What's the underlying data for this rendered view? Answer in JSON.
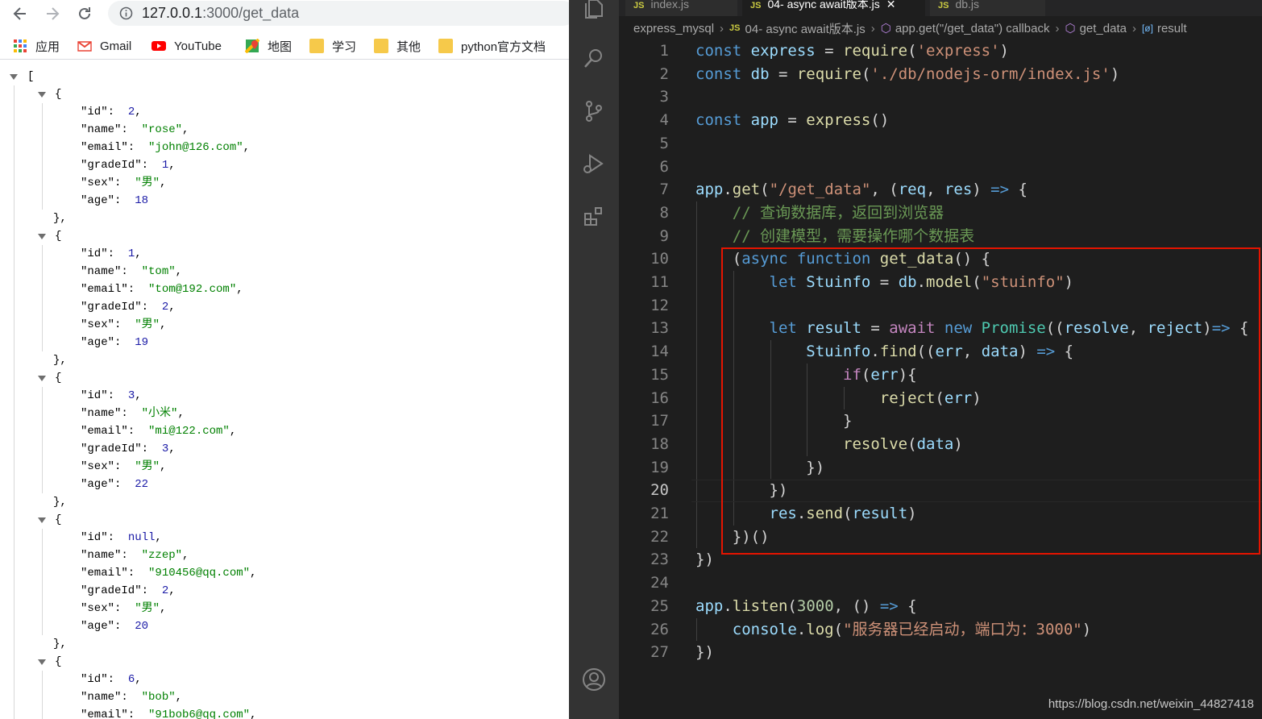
{
  "browser": {
    "url_host": "127.0.0.1",
    "url_path": ":3000/get_data",
    "bookmarks": [
      "应用",
      "Gmail",
      "YouTube",
      "地图",
      "学习",
      "其他",
      "python官方文档"
    ]
  },
  "json_records": [
    {
      "id": "2",
      "name": "\"rose\"",
      "email": "\"john@126.com\"",
      "gradeId": "1",
      "sex": "\"男\"",
      "age": "18"
    },
    {
      "id": "1",
      "name": "\"tom\"",
      "email": "\"tom@192.com\"",
      "gradeId": "2",
      "sex": "\"男\"",
      "age": "19"
    },
    {
      "id": "3",
      "name": "\"小米\"",
      "email": "\"mi@122.com\"",
      "gradeId": "3",
      "sex": "\"男\"",
      "age": "22"
    },
    {
      "id": "null",
      "name": "\"zzep\"",
      "email": "\"910456@qq.com\"",
      "gradeId": "2",
      "sex": "\"男\"",
      "age": "20"
    },
    {
      "id": "6",
      "name": "\"bob\"",
      "email": "\"91bob6@qq.com\""
    }
  ],
  "editor": {
    "tabs": [
      "index.js",
      "04- async await版本.js",
      "db.js"
    ],
    "breadcrumbs": [
      "express_mysql",
      "04- async await版本.js",
      "app.get(\"/get_data\") callback",
      "get_data",
      "result"
    ],
    "current_line": 20,
    "lines": [
      [
        [
          "kw",
          "const "
        ],
        [
          "var2",
          "express"
        ],
        [
          "pn",
          " = "
        ],
        [
          "fn",
          "require"
        ],
        [
          "pn",
          "("
        ],
        [
          "str",
          "'express'"
        ],
        [
          "pn",
          ")"
        ]
      ],
      [
        [
          "kw",
          "const "
        ],
        [
          "var2",
          "db"
        ],
        [
          "pn",
          " = "
        ],
        [
          "fn",
          "require"
        ],
        [
          "pn",
          "("
        ],
        [
          "str",
          "'./db/nodejs-orm/index.js'"
        ],
        [
          "pn",
          ")"
        ]
      ],
      [],
      [
        [
          "kw",
          "const "
        ],
        [
          "var2",
          "app"
        ],
        [
          "pn",
          " = "
        ],
        [
          "fn",
          "express"
        ],
        [
          "pn",
          "()"
        ]
      ],
      [],
      [],
      [
        [
          "var2",
          "app"
        ],
        [
          "pn",
          "."
        ],
        [
          "fn",
          "get"
        ],
        [
          "pn",
          "("
        ],
        [
          "str",
          "\"/get_data\""
        ],
        [
          "pn",
          ", ("
        ],
        [
          "var2",
          "req"
        ],
        [
          "pn",
          ", "
        ],
        [
          "var2",
          "res"
        ],
        [
          "pn",
          ") "
        ],
        [
          "kw",
          "=>"
        ],
        [
          "pn",
          " {"
        ]
      ],
      [
        [
          "pn",
          "    "
        ],
        [
          "cmt",
          "// 查询数据库，返回到浏览器"
        ]
      ],
      [
        [
          "pn",
          "    "
        ],
        [
          "cmt",
          "// 创建模型，需要操作哪个数据表"
        ]
      ],
      [
        [
          "pn",
          "    ("
        ],
        [
          "kw",
          "async function "
        ],
        [
          "fn",
          "get_data"
        ],
        [
          "pn",
          "() {"
        ]
      ],
      [
        [
          "pn",
          "        "
        ],
        [
          "kw",
          "let "
        ],
        [
          "var2",
          "Stuinfo"
        ],
        [
          "pn",
          " = "
        ],
        [
          "var2",
          "db"
        ],
        [
          "pn",
          "."
        ],
        [
          "fn",
          "model"
        ],
        [
          "pn",
          "("
        ],
        [
          "str",
          "\"stuinfo\""
        ],
        [
          "pn",
          ")"
        ]
      ],
      [],
      [
        [
          "pn",
          "        "
        ],
        [
          "kw",
          "let "
        ],
        [
          "var2",
          "result"
        ],
        [
          "pn",
          " = "
        ],
        [
          "ctl",
          "await "
        ],
        [
          "kw",
          "new "
        ],
        [
          "cls",
          "Promise"
        ],
        [
          "pn",
          "(("
        ],
        [
          "var2",
          "resolve"
        ],
        [
          "pn",
          ", "
        ],
        [
          "var2",
          "reject"
        ],
        [
          "pn",
          ")"
        ],
        [
          "kw",
          "=>"
        ],
        [
          "pn",
          " {"
        ]
      ],
      [
        [
          "pn",
          "            "
        ],
        [
          "var2",
          "Stuinfo"
        ],
        [
          "pn",
          "."
        ],
        [
          "fn",
          "find"
        ],
        [
          "pn",
          "(("
        ],
        [
          "var2",
          "err"
        ],
        [
          "pn",
          ", "
        ],
        [
          "var2",
          "data"
        ],
        [
          "pn",
          ") "
        ],
        [
          "kw",
          "=>"
        ],
        [
          "pn",
          " {"
        ]
      ],
      [
        [
          "pn",
          "                "
        ],
        [
          "ctl",
          "if"
        ],
        [
          "pn",
          "("
        ],
        [
          "var2",
          "err"
        ],
        [
          "pn",
          "){"
        ]
      ],
      [
        [
          "pn",
          "                    "
        ],
        [
          "fn",
          "reject"
        ],
        [
          "pn",
          "("
        ],
        [
          "var2",
          "err"
        ],
        [
          "pn",
          ")"
        ]
      ],
      [
        [
          "pn",
          "                }"
        ]
      ],
      [
        [
          "pn",
          "                "
        ],
        [
          "fn",
          "resolve"
        ],
        [
          "pn",
          "("
        ],
        [
          "var2",
          "data"
        ],
        [
          "pn",
          ")"
        ]
      ],
      [
        [
          "pn",
          "            })"
        ]
      ],
      [
        [
          "pn",
          "        })"
        ]
      ],
      [
        [
          "pn",
          "        "
        ],
        [
          "var2",
          "res"
        ],
        [
          "pn",
          "."
        ],
        [
          "fn",
          "send"
        ],
        [
          "pn",
          "("
        ],
        [
          "var2",
          "result"
        ],
        [
          "pn",
          ")"
        ]
      ],
      [
        [
          "pn",
          "    })()"
        ]
      ],
      [
        [
          "pn",
          "})"
        ]
      ],
      [],
      [
        [
          "var2",
          "app"
        ],
        [
          "pn",
          "."
        ],
        [
          "fn",
          "listen"
        ],
        [
          "pn",
          "("
        ],
        [
          "num",
          "3000"
        ],
        [
          "pn",
          ", () "
        ],
        [
          "kw",
          "=>"
        ],
        [
          "pn",
          " {"
        ]
      ],
      [
        [
          "pn",
          "    "
        ],
        [
          "var2",
          "console"
        ],
        [
          "pn",
          "."
        ],
        [
          "fn",
          "log"
        ],
        [
          "pn",
          "("
        ],
        [
          "str",
          "\"服务器已经启动，端口为：3000\""
        ],
        [
          "pn",
          ")"
        ]
      ],
      [
        [
          "pn",
          "})"
        ]
      ]
    ]
  },
  "watermark": "https://blog.csdn.net/weixin_44827418",
  "colors": {
    "highlight_box": "#e51400",
    "editor_bg": "#1e1e1e",
    "activity_bar": "#333333"
  }
}
